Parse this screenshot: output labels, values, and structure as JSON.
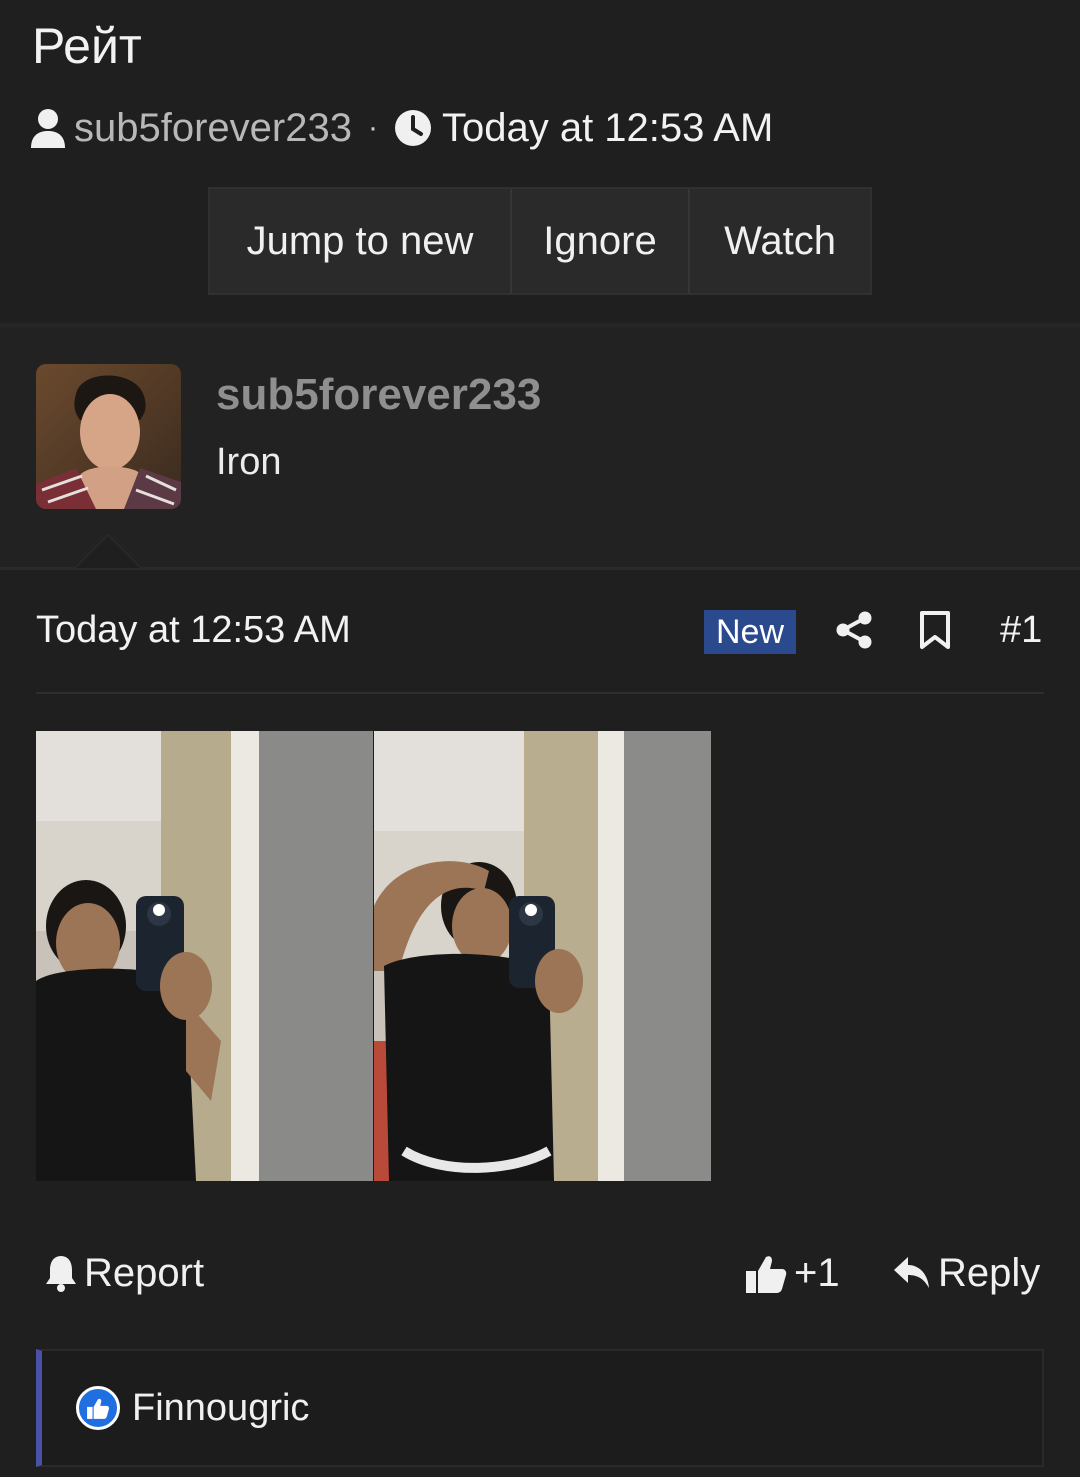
{
  "thread": {
    "title": "Рейт",
    "author": "sub5forever233",
    "separator": "·",
    "time": "Today at 12:53 AM",
    "buttons": {
      "jump_to_new": "Jump to new",
      "ignore": "Ignore",
      "watch": "Watch"
    }
  },
  "user": {
    "name": "sub5forever233",
    "title": "Iron"
  },
  "post": {
    "time": "Today at 12:53 AM",
    "badge": "New",
    "number": "#1",
    "icons": [
      "share-icon",
      "bookmark-icon"
    ]
  },
  "actions": {
    "report": "Report",
    "like_count": "+1",
    "reply": "Reply"
  },
  "reactions": {
    "users": [
      "Finnougric"
    ],
    "icon": "thumbs-up-icon"
  },
  "colors": {
    "background": "#1f1f1f",
    "badge": "#2b4a8e",
    "reaction_accent": "#4a52a8",
    "like_blue": "#1f6fe0"
  }
}
